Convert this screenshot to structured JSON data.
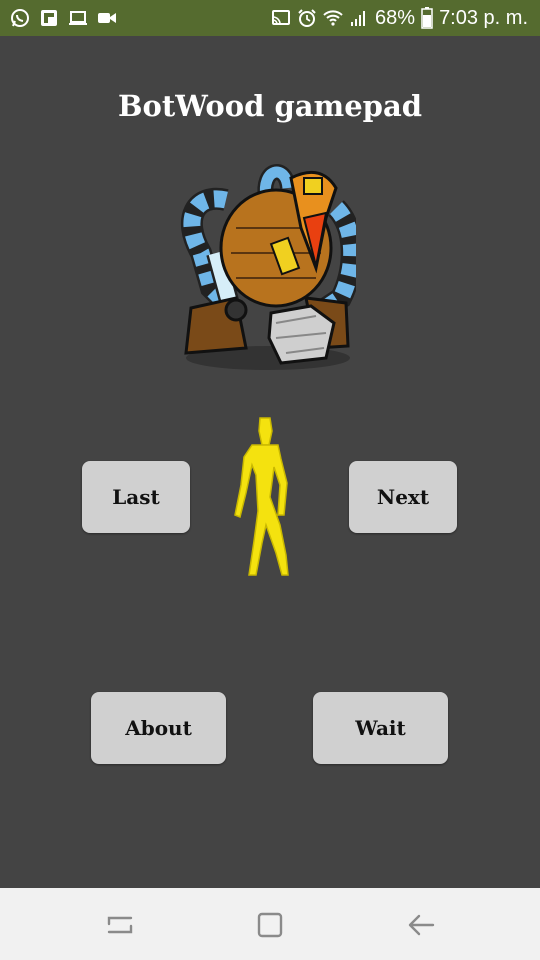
{
  "status_bar": {
    "battery": "68%",
    "time": "7:03 p. m.",
    "bg_color": "#556b2f",
    "icons_left": [
      "whatsapp-icon",
      "flipboard-icon",
      "laptop-icon",
      "video-camera-icon"
    ],
    "icons_right": [
      "cast-icon",
      "alarm-icon",
      "wifi-icon",
      "signal-icon",
      "battery-icon"
    ]
  },
  "app": {
    "title": "BotWood gamepad",
    "bg_color": "#444444"
  },
  "buttons": {
    "last": "Last",
    "next": "Next",
    "about": "About",
    "wait": "Wait"
  },
  "images": {
    "robot": "robot-illustration",
    "figure": "yellow-stick-figure"
  },
  "nav_bar": {
    "icons": [
      "recent-apps-icon",
      "home-icon",
      "back-icon"
    ]
  }
}
